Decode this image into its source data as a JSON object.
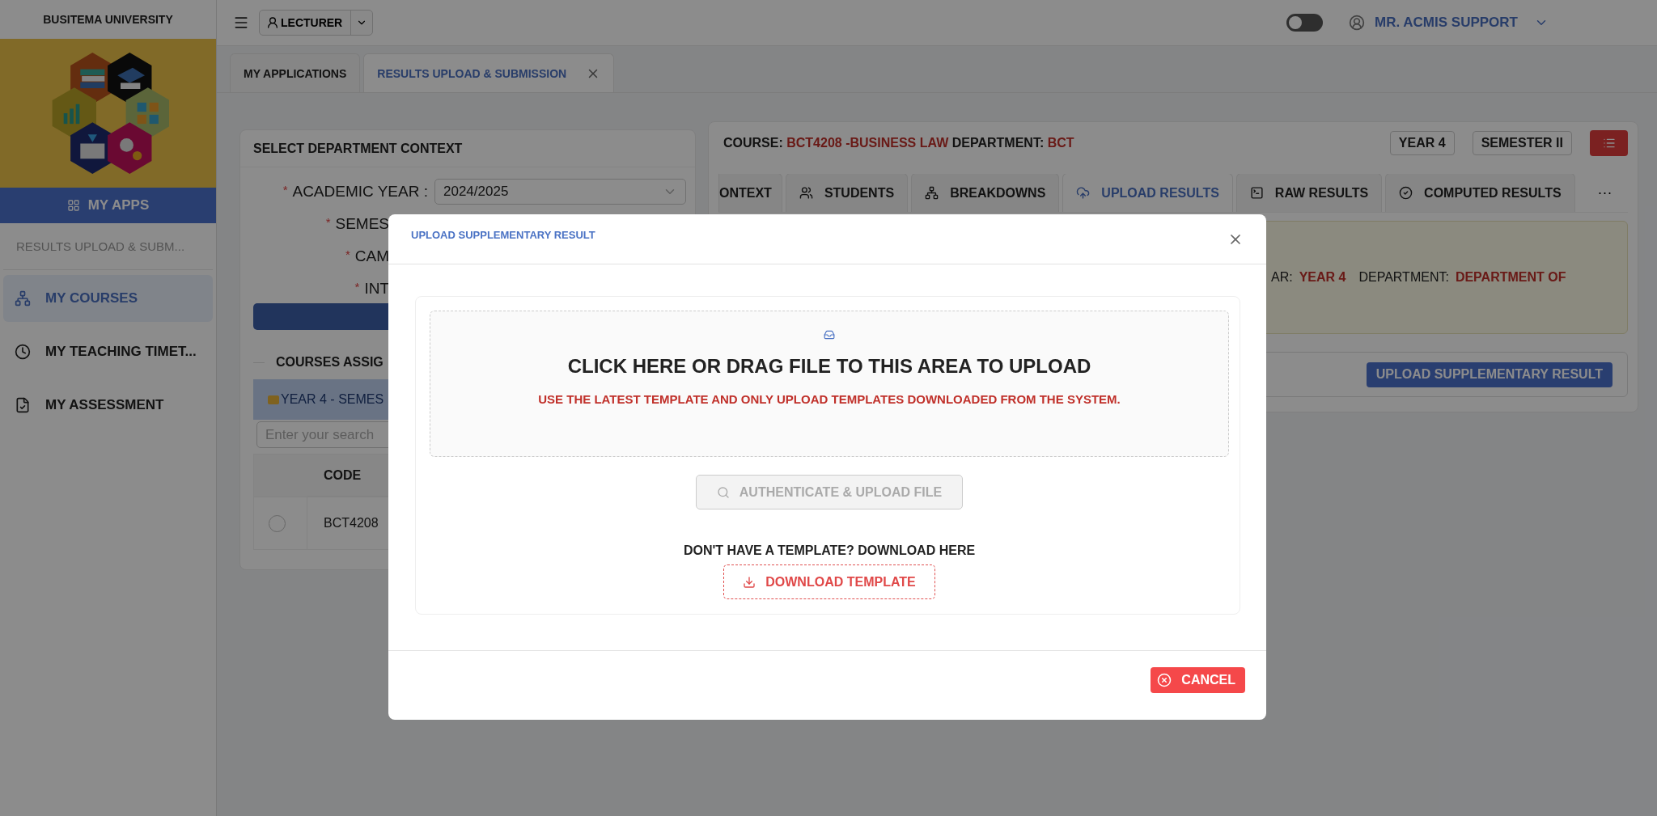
{
  "sidebar": {
    "university": "BUSITEMA UNIVERSITY",
    "apps_button": "MY APPS",
    "section_label": "RESULTS UPLOAD & SUBM...",
    "items": [
      {
        "label": "MY COURSES",
        "selected": true
      },
      {
        "label": "MY TEACHING TIMET...",
        "selected": false
      },
      {
        "label": "MY ASSESSMENT",
        "selected": false
      }
    ]
  },
  "topbar": {
    "role_button": "LECTURER",
    "dark_mode": false,
    "user": "MR. ACMIS SUPPORT"
  },
  "page_tabs": [
    {
      "label": "MY APPLICATIONS",
      "selected": false,
      "closable": false
    },
    {
      "label": "RESULTS UPLOAD & SUBMISSION",
      "selected": true,
      "closable": true
    }
  ],
  "context_panel": {
    "title": "SELECT DEPARTMENT CONTEXT",
    "fields": [
      {
        "label": "ACADEMIC YEAR :",
        "required": true,
        "required_mark": "*",
        "value": "2024/2025"
      },
      {
        "label": "SEMES",
        "required": true,
        "required_mark": "*"
      },
      {
        "label": "CAM",
        "required": true,
        "required_mark": "*"
      },
      {
        "label": "INT",
        "required": true,
        "required_mark": "*"
      }
    ],
    "courses_heading": "COURSES ASSIG",
    "group": "YEAR 4 - SEMES",
    "search_placeholder": "Enter your search",
    "columns": [
      "CODE"
    ],
    "rows": [
      {
        "code": "BCT4208",
        "selected": false
      }
    ]
  },
  "course_panel": {
    "course_label": "COURSE:",
    "course": "BCT4208 -BUSINESS LAW",
    "department_label": "DEPARTMENT:",
    "department": "BCT",
    "badges": [
      "YEAR 4",
      "SEMESTER II"
    ],
    "tabs": [
      {
        "label": "ONTEXT",
        "selected": false
      },
      {
        "label": "STUDENTS",
        "selected": false
      },
      {
        "label": "BREAKDOWNS",
        "selected": false
      },
      {
        "label": "UPLOAD RESULTS",
        "selected": true
      },
      {
        "label": "RAW RESULTS",
        "selected": false
      },
      {
        "label": "COMPUTED RESULTS",
        "selected": false
      }
    ],
    "more": "···",
    "info": [
      {
        "label": "AR:",
        "value": "YEAR 4"
      },
      {
        "label": "DEPARTMENT:",
        "value": "DEPARTMENT OF"
      }
    ],
    "supplementary_button": "UPLOAD SUPPLEMENTARY RESULT"
  },
  "modal": {
    "title": "UPLOAD SUPPLEMENTARY RESULT",
    "drop_title": "CLICK HERE OR DRAG FILE TO THIS AREA TO UPLOAD",
    "drop_hint": "USE THE LATEST TEMPLATE AND ONLY UPLOAD TEMPLATES DOWNLOADED FROM THE SYSTEM.",
    "auth_button": {
      "label": "AUTHENTICATE & UPLOAD FILE",
      "disabled": true
    },
    "template_prompt": "DON'T HAVE A TEMPLATE? DOWNLOAD HERE",
    "download_button": "DOWNLOAD TEMPLATE",
    "cancel_button": "CANCEL"
  }
}
